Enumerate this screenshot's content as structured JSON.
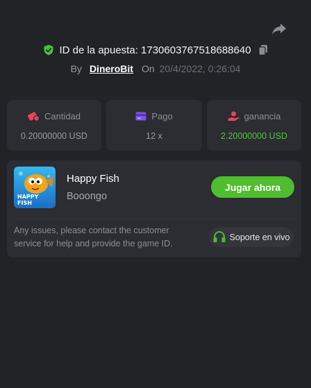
{
  "header": {
    "bet_id_label": "ID de la apuesta: 1730603767518688640",
    "by_label": "By",
    "author": "DineroBit",
    "on_label": "On",
    "date": "20/4/2022, 0:26:04"
  },
  "stats": {
    "amount": {
      "label": "Cantidad",
      "value": "0.20000000 USD"
    },
    "payout": {
      "label": "Pago",
      "value": "12 x"
    },
    "profit": {
      "label": "ganancia",
      "value": "2.20000000 USD"
    }
  },
  "game": {
    "thumbnail_text_1": "HAPPY",
    "thumbnail_text_2": "FISH",
    "title": "Happy Fish",
    "provider": "Booongo",
    "play_label": "Jugar ahora"
  },
  "support": {
    "help_text": "Any issues, please contact the customer service for help and provide the game ID.",
    "button_label": "Soporte en vivo"
  },
  "colors": {
    "background": "#222327",
    "card": "#2b2d33",
    "accent_green": "#4fbd2d",
    "profit_green": "#54c43a",
    "amount_icon": "#e8455b",
    "payout_icon": "#7b53e8"
  },
  "icons": {
    "share": "share-icon",
    "shield": "shield-check-icon",
    "copy": "copy-icon",
    "amount": "coins-icon",
    "payout": "card-icon",
    "profit": "hand-coin-icon",
    "support": "headset-icon"
  }
}
